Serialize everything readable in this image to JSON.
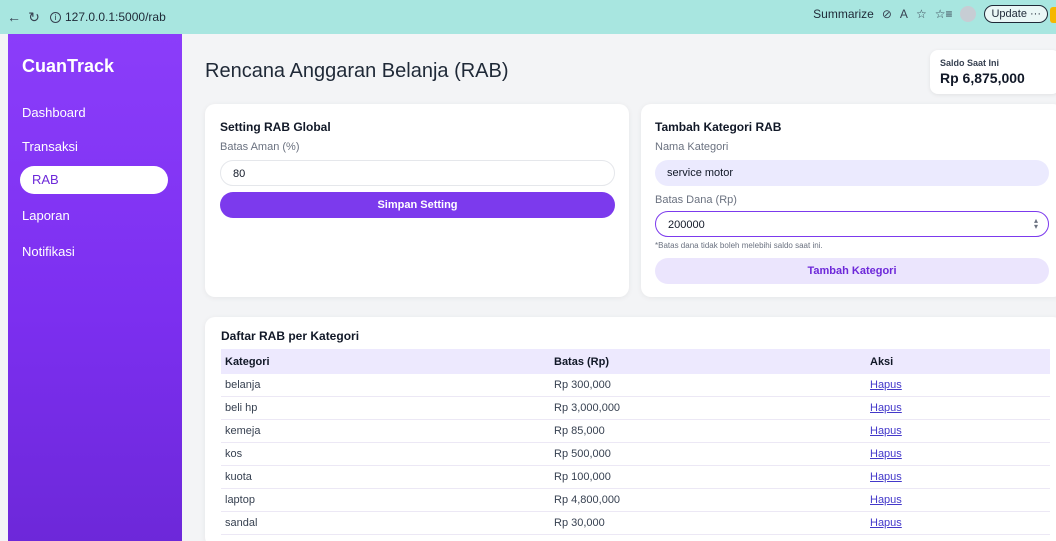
{
  "browser": {
    "url": "127.0.0.1:5000/rab",
    "summarize_label": "Summarize",
    "update_label": "Update"
  },
  "sidebar": {
    "brand": "CuanTrack",
    "items": [
      {
        "label": "Dashboard"
      },
      {
        "label": "Transaksi"
      },
      {
        "label": "RAB",
        "active": true
      },
      {
        "label": "Laporan"
      },
      {
        "label": "Notifikasi"
      }
    ]
  },
  "header": {
    "title": "Rencana Anggaran Belanja (RAB)",
    "saldo_label": "Saldo Saat Ini",
    "saldo_value": "Rp 6,875,000"
  },
  "setting_card": {
    "title": "Setting RAB Global",
    "field_label": "Batas Aman (%)",
    "field_value": "80",
    "button_label": "Simpan Setting"
  },
  "kategori_card": {
    "title": "Tambah Kategori RAB",
    "name_label": "Nama Kategori",
    "name_value": "service motor",
    "limit_label": "Batas Dana (Rp)",
    "limit_value": "200000",
    "hint": "*Batas dana tidak boleh melebihi saldo saat ini.",
    "button_label": "Tambah Kategori"
  },
  "table": {
    "title": "Daftar RAB per Kategori",
    "headers": [
      "Kategori",
      "Batas (Rp)",
      "Aksi"
    ],
    "rows": [
      {
        "kategori": "belanja",
        "batas": "Rp 300,000",
        "aksi": "Hapus"
      },
      {
        "kategori": "beli hp",
        "batas": "Rp 3,000,000",
        "aksi": "Hapus"
      },
      {
        "kategori": "kemeja",
        "batas": "Rp 85,000",
        "aksi": "Hapus"
      },
      {
        "kategori": "kos",
        "batas": "Rp 500,000",
        "aksi": "Hapus"
      },
      {
        "kategori": "kuota",
        "batas": "Rp 100,000",
        "aksi": "Hapus"
      },
      {
        "kategori": "laptop",
        "batas": "Rp 4,800,000",
        "aksi": "Hapus"
      },
      {
        "kategori": "sandal",
        "batas": "Rp 30,000",
        "aksi": "Hapus"
      }
    ]
  },
  "colors": {
    "accent": "#7c3aed",
    "sidebar": "#8b3dfa",
    "browser_bar": "#a8e6e0"
  }
}
